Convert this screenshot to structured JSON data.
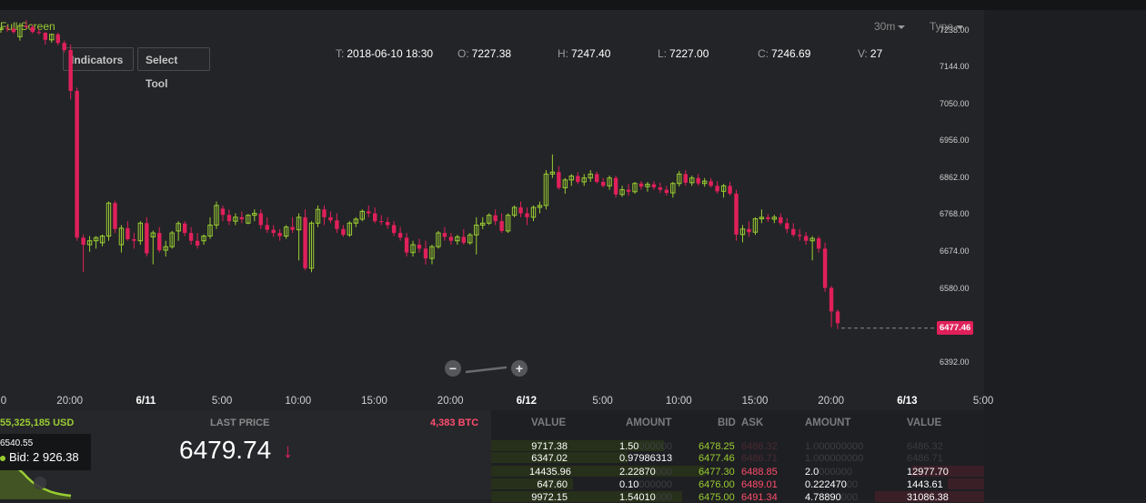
{
  "toolbar": {
    "fullscreen": "Full Screen",
    "timeframe": "30m",
    "type": "Type",
    "indicators": "Indicators",
    "select_tool": "Select Tool"
  },
  "ohlc": {
    "t_label": "T:",
    "t_value": "2018-06-10 18:30",
    "o_label": "O:",
    "o_value": "7227.38",
    "h_label": "H:",
    "h_value": "7247.40",
    "l_label": "L:",
    "l_value": "7227.00",
    "c_label": "C:",
    "c_value": "7246.69",
    "v_label": "V:",
    "v_value": "27"
  },
  "y_axis": [
    "7238.00",
    "7144.00",
    "7050.00",
    "6956.00",
    "6862.00",
    "6768.00",
    "6674.00",
    "6580.00",
    "6392.00"
  ],
  "x_axis": [
    {
      "label": "0",
      "day": false
    },
    {
      "label": "20:00",
      "day": false
    },
    {
      "label": "6/11",
      "day": true
    },
    {
      "label": "5:00",
      "day": false
    },
    {
      "label": "10:00",
      "day": false
    },
    {
      "label": "15:00",
      "day": false
    },
    {
      "label": "20:00",
      "day": false
    },
    {
      "label": "6/12",
      "day": true
    },
    {
      "label": "5:00",
      "day": false
    },
    {
      "label": "10:00",
      "day": false
    },
    {
      "label": "15:00",
      "day": false
    },
    {
      "label": "20:00",
      "day": false
    },
    {
      "label": "6/13",
      "day": true
    },
    {
      "label": "5:00",
      "day": false
    }
  ],
  "current_price_tag": "6477.46",
  "colors": {
    "up": "#9acd32",
    "down": "#e0205a",
    "background": "#232427"
  },
  "chart_data": {
    "type": "candlestick",
    "interval": "30m",
    "y_ticks": [
      7238,
      7144,
      7050,
      6956,
      6862,
      6768,
      6674,
      6580,
      6392
    ],
    "ylim": [
      6361,
      7288
    ],
    "last_price": 6477.46,
    "ohlc": [
      [
        7238,
        7244,
        7230,
        7242
      ],
      [
        7242,
        7248,
        7232,
        7240
      ],
      [
        7240,
        7245,
        7228,
        7232
      ],
      [
        7220,
        7255,
        7210,
        7248
      ],
      [
        7248,
        7262,
        7240,
        7245
      ],
      [
        7245,
        7250,
        7228,
        7232
      ],
      [
        7232,
        7240,
        7225,
        7230
      ],
      [
        7230,
        7232,
        7200,
        7212
      ],
      [
        7212,
        7228,
        7205,
        7226
      ],
      [
        7226,
        7230,
        7198,
        7204
      ],
      [
        7204,
        7210,
        7180,
        7186
      ],
      [
        7186,
        7200,
        7060,
        7082
      ],
      [
        7082,
        7090,
        6700,
        6708
      ],
      [
        6708,
        6716,
        6620,
        6690
      ],
      [
        6690,
        6712,
        6672,
        6700
      ],
      [
        6700,
        6712,
        6680,
        6708
      ],
      [
        6695,
        6716,
        6686,
        6712
      ],
      [
        6712,
        6800,
        6700,
        6796
      ],
      [
        6796,
        6802,
        6720,
        6730
      ],
      [
        6690,
        6740,
        6670,
        6732
      ],
      [
        6732,
        6750,
        6700,
        6704
      ],
      [
        6704,
        6720,
        6680,
        6700
      ],
      [
        6700,
        6750,
        6690,
        6745
      ],
      [
        6745,
        6760,
        6660,
        6668
      ],
      [
        6710,
        6726,
        6640,
        6720
      ],
      [
        6720,
        6735,
        6670,
        6676
      ],
      [
        6676,
        6700,
        6660,
        6685
      ],
      [
        6685,
        6725,
        6680,
        6720
      ],
      [
        6725,
        6750,
        6700,
        6744
      ],
      [
        6744,
        6750,
        6712,
        6720
      ],
      [
        6720,
        6735,
        6690,
        6700
      ],
      [
        6700,
        6720,
        6680,
        6688
      ],
      [
        6700,
        6716,
        6690,
        6712
      ],
      [
        6712,
        6760,
        6705,
        6740
      ],
      [
        6740,
        6800,
        6730,
        6790
      ],
      [
        6782,
        6790,
        6750,
        6766
      ],
      [
        6766,
        6780,
        6740,
        6750
      ],
      [
        6750,
        6770,
        6740,
        6760
      ],
      [
        6760,
        6775,
        6745,
        6755
      ],
      [
        6745,
        6768,
        6742,
        6765
      ],
      [
        6765,
        6780,
        6750,
        6770
      ],
      [
        6770,
        6780,
        6730,
        6740
      ],
      [
        6740,
        6760,
        6720,
        6728
      ],
      [
        6728,
        6740,
        6710,
        6720
      ],
      [
        6720,
        6730,
        6700,
        6712
      ],
      [
        6712,
        6740,
        6705,
        6735
      ],
      [
        6735,
        6760,
        6720,
        6728
      ],
      [
        6728,
        6770,
        6650,
        6760
      ],
      [
        6760,
        6780,
        6625,
        6630
      ],
      [
        6630,
        6750,
        6620,
        6745
      ],
      [
        6745,
        6790,
        6735,
        6780
      ],
      [
        6780,
        6790,
        6740,
        6760
      ],
      [
        6760,
        6775,
        6745,
        6752
      ],
      [
        6752,
        6770,
        6720,
        6730
      ],
      [
        6730,
        6740,
        6710,
        6715
      ],
      [
        6715,
        6750,
        6710,
        6745
      ],
      [
        6745,
        6760,
        6735,
        6755
      ],
      [
        6755,
        6780,
        6750,
        6775
      ],
      [
        6775,
        6790,
        6760,
        6770
      ],
      [
        6770,
        6785,
        6745,
        6750
      ],
      [
        6750,
        6765,
        6740,
        6748
      ],
      [
        6748,
        6760,
        6730,
        6740
      ],
      [
        6740,
        6750,
        6712,
        6720
      ],
      [
        6720,
        6735,
        6700,
        6708
      ],
      [
        6708,
        6720,
        6660,
        6670
      ],
      [
        6670,
        6700,
        6660,
        6690
      ],
      [
        6690,
        6705,
        6670,
        6680
      ],
      [
        6680,
        6700,
        6640,
        6655
      ],
      [
        6655,
        6690,
        6640,
        6685
      ],
      [
        6685,
        6725,
        6680,
        6720
      ],
      [
        6720,
        6735,
        6700,
        6710
      ],
      [
        6710,
        6720,
        6690,
        6700
      ],
      [
        6700,
        6715,
        6690,
        6710
      ],
      [
        6710,
        6730,
        6690,
        6695
      ],
      [
        6695,
        6720,
        6690,
        6715
      ],
      [
        6715,
        6760,
        6665,
        6740
      ],
      [
        6740,
        6760,
        6730,
        6745
      ],
      [
        6745,
        6770,
        6740,
        6765
      ],
      [
        6765,
        6780,
        6740,
        6750
      ],
      [
        6750,
        6770,
        6720,
        6725
      ],
      [
        6725,
        6770,
        6720,
        6765
      ],
      [
        6765,
        6790,
        6760,
        6785
      ],
      [
        6785,
        6800,
        6760,
        6770
      ],
      [
        6770,
        6785,
        6740,
        6760
      ],
      [
        6760,
        6790,
        6750,
        6785
      ],
      [
        6785,
        6800,
        6770,
        6790
      ],
      [
        6790,
        6880,
        6780,
        6870
      ],
      [
        6870,
        6920,
        6860,
        6875
      ],
      [
        6875,
        6890,
        6830,
        6835
      ],
      [
        6835,
        6860,
        6820,
        6855
      ],
      [
        6855,
        6870,
        6840,
        6865
      ],
      [
        6865,
        6875,
        6845,
        6850
      ],
      [
        6850,
        6870,
        6840,
        6860
      ],
      [
        6860,
        6880,
        6850,
        6870
      ],
      [
        6870,
        6876,
        6846,
        6850
      ],
      [
        6850,
        6860,
        6836,
        6840
      ],
      [
        6840,
        6866,
        6830,
        6860
      ],
      [
        6860,
        6866,
        6810,
        6818
      ],
      [
        6818,
        6840,
        6812,
        6830
      ],
      [
        6830,
        6845,
        6815,
        6825
      ],
      [
        6825,
        6850,
        6820,
        6846
      ],
      [
        6846,
        6852,
        6830,
        6838
      ],
      [
        6838,
        6850,
        6825,
        6844
      ],
      [
        6844,
        6852,
        6830,
        6836
      ],
      [
        6836,
        6848,
        6822,
        6830
      ],
      [
        6830,
        6840,
        6815,
        6822
      ],
      [
        6822,
        6850,
        6810,
        6846
      ],
      [
        6846,
        6878,
        6838,
        6870
      ],
      [
        6870,
        6880,
        6840,
        6848
      ],
      [
        6848,
        6866,
        6840,
        6860
      ],
      [
        6860,
        6870,
        6840,
        6846
      ],
      [
        6846,
        6860,
        6838,
        6852
      ],
      [
        6852,
        6860,
        6836,
        6840
      ],
      [
        6840,
        6852,
        6820,
        6826
      ],
      [
        6826,
        6845,
        6810,
        6840
      ],
      [
        6840,
        6850,
        6815,
        6820
      ],
      [
        6820,
        6830,
        6700,
        6716
      ],
      [
        6716,
        6740,
        6696,
        6730
      ],
      [
        6730,
        6750,
        6710,
        6722
      ],
      [
        6722,
        6760,
        6715,
        6756
      ],
      [
        6756,
        6780,
        6745,
        6760
      ],
      [
        6760,
        6768,
        6748,
        6755
      ],
      [
        6755,
        6766,
        6745,
        6760
      ],
      [
        6760,
        6770,
        6740,
        6745
      ],
      [
        6745,
        6758,
        6720,
        6730
      ],
      [
        6730,
        6745,
        6710,
        6715
      ],
      [
        6715,
        6730,
        6700,
        6712
      ],
      [
        6712,
        6722,
        6690,
        6700
      ],
      [
        6700,
        6712,
        6650,
        6706
      ],
      [
        6706,
        6712,
        6670,
        6680
      ],
      [
        6680,
        6695,
        6570,
        6580
      ],
      [
        6580,
        6585,
        6480,
        6520
      ],
      [
        6520,
        6525,
        6475,
        6490
      ]
    ]
  },
  "bottom": {
    "usd_volume": "55,325,185 USD",
    "last_price_label": "LAST PRICE",
    "btc_volume": "4,383 BTC",
    "last_price": "6479.74",
    "tooltip_top": "6540.55",
    "tooltip_bid": "Bid: 2 926.38"
  },
  "orderbook": {
    "headers": {
      "value_l": "VALUE",
      "amount_l": "AMOUNT",
      "bid": "BID",
      "ask": "ASK",
      "amount_r": "AMOUNT",
      "value_r": "VALUE"
    },
    "rows": [
      {
        "bid_value": "9717.38",
        "bid_amount": "1.50",
        "bid_amount_tail": "000000",
        "bid": "6478.25",
        "ask": "6486.32",
        "ask_amount": "1.0",
        "ask_amount_tail": "00000000",
        "ask_value": "6486.32",
        "ghost": true
      },
      {
        "bid_value": "6347.02",
        "bid_amount": "0.97986313",
        "bid_amount_tail": "",
        "bid": "6477.46",
        "ask": "6486.71",
        "ask_amount": "1.0",
        "ask_amount_tail": "00000000",
        "ask_value": "6486.71",
        "ghost": true
      },
      {
        "bid_value": "14435.96",
        "bid_amount": "2.22870",
        "bid_amount_tail": "000",
        "bid": "6477.30",
        "ask": "6488.85",
        "ask_amount": "2.0",
        "ask_amount_tail": "000000",
        "ask_value": "12977.70",
        "ghost": false
      },
      {
        "bid_value": "647.60",
        "bid_amount": "0.10",
        "bid_amount_tail": "000000",
        "bid": "6476.00",
        "ask": "6489.01",
        "ask_amount": "0.222470",
        "ask_amount_tail": "00",
        "ask_value": "1443.61",
        "ghost": false
      },
      {
        "bid_value": "9972.15",
        "bid_amount": "1.54010",
        "bid_amount_tail": "000",
        "bid": "6475.00",
        "ask": "6491.34",
        "ask_amount": "4.78890",
        "ask_amount_tail": "000",
        "ask_value": "31086.38",
        "ghost": false
      }
    ]
  }
}
